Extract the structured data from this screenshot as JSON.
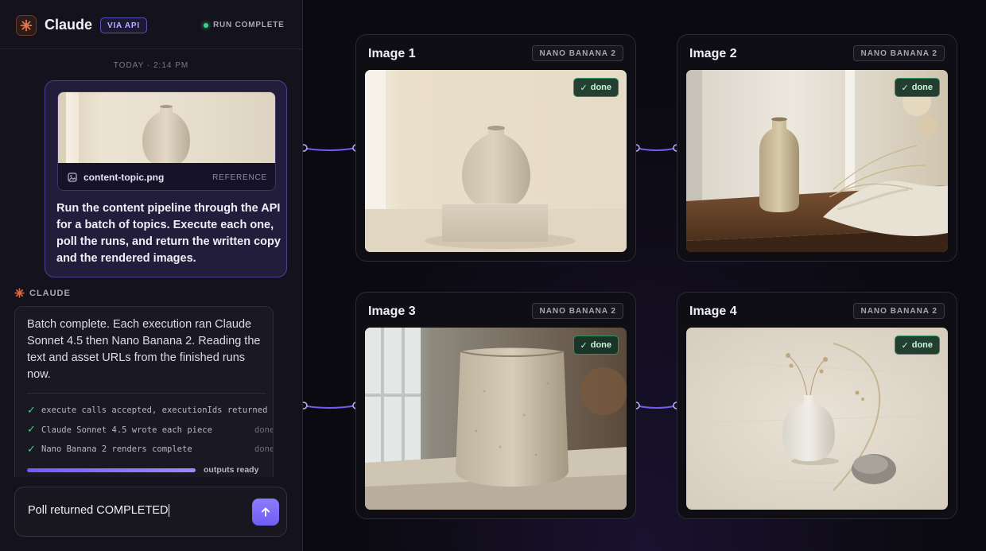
{
  "header": {
    "app_title": "Claude",
    "via_badge": "VIA API",
    "status": "RUN COMPLETE"
  },
  "conversation": {
    "timestamp": "TODAY · 2:14 PM",
    "user_message": {
      "attachment_name": "content-topic.png",
      "attachment_label": "REFERENCE",
      "text": "Run the content pipeline through the API for a batch of topics. Execute each one, poll the runs, and return the written copy and the rendered images."
    },
    "assistant_label": "CLAUDE",
    "assistant_message": {
      "text": "Batch complete. Each execution ran Claude Sonnet 4.5 then Nano Banana 2. Reading the text and asset URLs from the finished runs now.",
      "steps": [
        {
          "text": "execute calls accepted, executionIds returned",
          "status": "done"
        },
        {
          "text": "Claude Sonnet 4.5 wrote each piece",
          "status": "done"
        },
        {
          "text": "Nano Banana 2 renders complete",
          "status": "done"
        }
      ],
      "progress": 1.0,
      "progress_label": "outputs ready"
    }
  },
  "composer": {
    "value": "Poll returned COMPLETED"
  },
  "images": [
    {
      "title": "Image 1",
      "model": "NANO BANANA 2",
      "status": "done"
    },
    {
      "title": "Image 2",
      "model": "NANO BANANA 2",
      "status": "done"
    },
    {
      "title": "Image 3",
      "model": "NANO BANANA 2",
      "status": "done"
    },
    {
      "title": "Image 4",
      "model": "NANO BANANA 2",
      "status": "done"
    }
  ],
  "icons": {
    "logo": "claude-starburst-icon",
    "attachment": "image-file-icon",
    "send": "arrow-up-icon",
    "step": "check-icon"
  },
  "colors": {
    "accent": "#7c6cff",
    "success": "#3ed28a",
    "brand": "#d86a4a"
  }
}
